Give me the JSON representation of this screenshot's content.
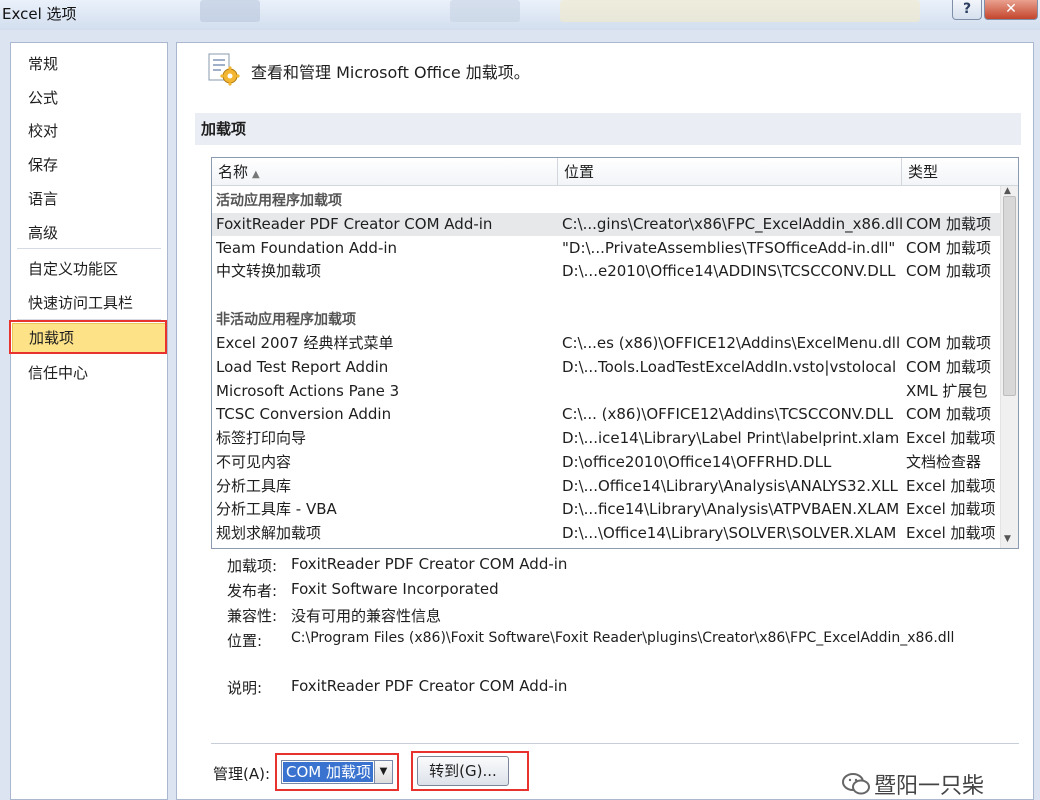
{
  "window": {
    "title": "Excel 选项",
    "help_label": "?",
    "close_label": "✕"
  },
  "nav": {
    "items": [
      {
        "label": "常规"
      },
      {
        "label": "公式"
      },
      {
        "label": "校对"
      },
      {
        "label": "保存"
      },
      {
        "label": "语言"
      },
      {
        "label": "高级"
      },
      {
        "label": "自定义功能区"
      },
      {
        "label": "快速访问工具栏"
      },
      {
        "label": "加载项"
      },
      {
        "label": "信任中心"
      }
    ],
    "selected": "加载项"
  },
  "header": {
    "text": "查看和管理 Microsoft Office 加载项。",
    "icon": "addin-gear-icon"
  },
  "section_title": "加载项",
  "table": {
    "columns": [
      "名称",
      "位置",
      "类型"
    ],
    "sort_indicator": "▲",
    "groups": [
      {
        "title": "活动应用程序加载项",
        "rows": [
          {
            "name": "FoxitReader PDF Creator COM Add-in",
            "location": "C:\\...gins\\Creator\\x86\\FPC_ExcelAddin_x86.dll",
            "type": "COM 加载项",
            "selected": true
          },
          {
            "name": "Team Foundation Add-in",
            "location": "\"D:\\...PrivateAssemblies\\TFSOfficeAdd-in.dll\"",
            "type": "COM 加载项"
          },
          {
            "name": "中文转换加载项",
            "location": "D:\\...e2010\\Office14\\ADDINS\\TCSCCONV.DLL",
            "type": "COM 加载项"
          }
        ]
      },
      {
        "title": "非活动应用程序加载项",
        "rows": [
          {
            "name": "Excel 2007 经典样式菜单",
            "location": "C:\\...es (x86)\\OFFICE12\\Addins\\ExcelMenu.dll",
            "type": "COM 加载项"
          },
          {
            "name": "Load Test Report Addin",
            "location": "D:\\...Tools.LoadTestExcelAddIn.vsto|vstolocal",
            "type": "COM 加载项"
          },
          {
            "name": "Microsoft Actions Pane 3",
            "location": "",
            "type": "XML 扩展包"
          },
          {
            "name": "TCSC Conversion Addin",
            "location": "C:\\... (x86)\\OFFICE12\\Addins\\TCSCCONV.DLL",
            "type": "COM 加载项"
          },
          {
            "name": "标签打印向导",
            "location": "D:\\...ice14\\Library\\Label Print\\labelprint.xlam",
            "type": "Excel 加载项"
          },
          {
            "name": "不可见内容",
            "location": "D:\\office2010\\Office14\\OFFRHD.DLL",
            "type": "文档检查器"
          },
          {
            "name": "分析工具库",
            "location": "D:\\...Office14\\Library\\Analysis\\ANALYS32.XLL",
            "type": "Excel 加载项"
          },
          {
            "name": "分析工具库 - VBA",
            "location": "D:\\...fice14\\Library\\Analysis\\ATPVBAEN.XLAM",
            "type": "Excel 加载项"
          },
          {
            "name": "规划求解加载项",
            "location": "D:\\...\\Office14\\Library\\SOLVER\\SOLVER.XLAM",
            "type": "Excel 加载项"
          }
        ]
      }
    ]
  },
  "details": {
    "addin_label": "加载项:",
    "addin_value": "FoxitReader PDF Creator COM Add-in",
    "publisher_label": "发布者:",
    "publisher_value": "Foxit Software Incorporated",
    "compat_label": "兼容性:",
    "compat_value": "没有可用的兼容性信息",
    "location_label": "位置:",
    "location_value": "C:\\Program Files (x86)\\Foxit Software\\Foxit Reader\\plugins\\Creator\\x86\\FPC_ExcelAddin_x86.dll",
    "desc_label": "说明:",
    "desc_value": "FoxitReader PDF Creator COM Add-in"
  },
  "manage": {
    "label": "管理(A):",
    "selected": "COM 加载项",
    "go_label": "转到(G)..."
  },
  "watermark": {
    "text": "暨阳一只柴"
  },
  "colors": {
    "highlight": "#e8322e",
    "nav_selected": "#fde288",
    "select_blue": "#3a73cf"
  }
}
